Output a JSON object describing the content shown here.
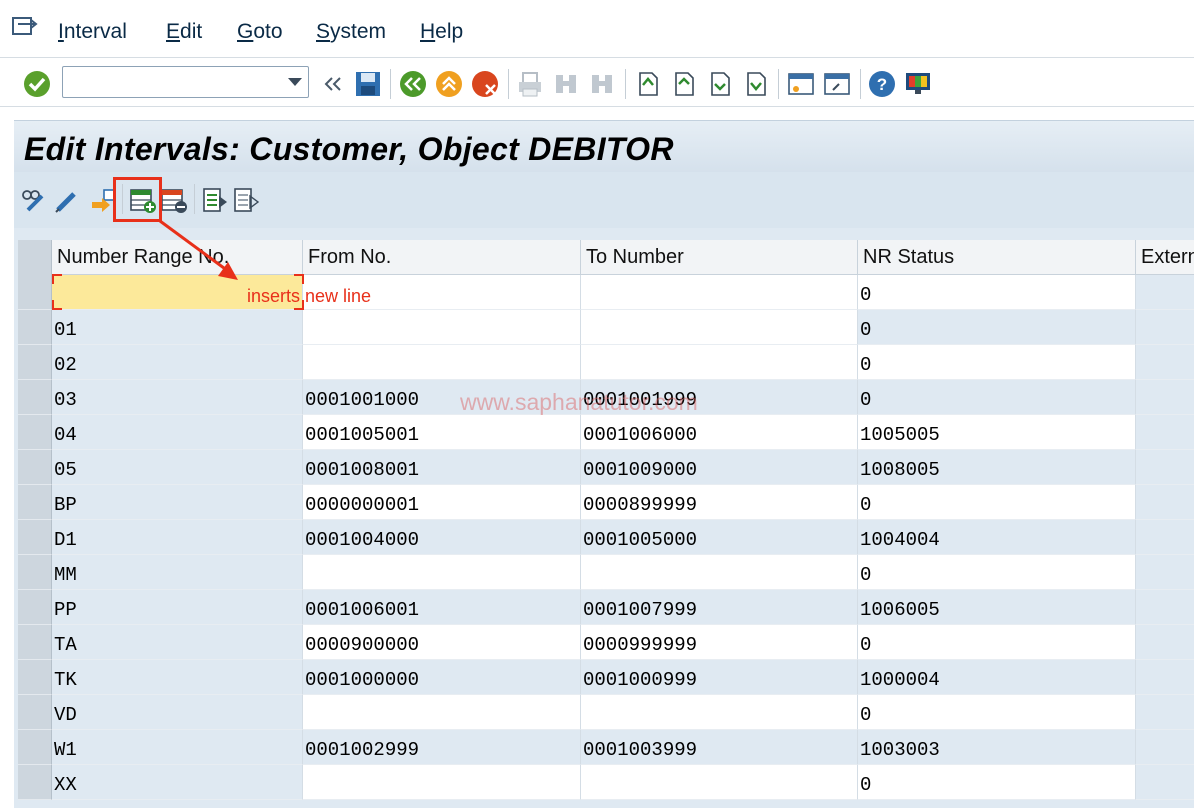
{
  "menu": {
    "items": [
      "Interval",
      "Edit",
      "Goto",
      "System",
      "Help"
    ]
  },
  "toolbar": {
    "command_field_value": "",
    "icons": [
      "enter-icon",
      "back-icon",
      "save-icon",
      "green-back-icon",
      "exit-icon",
      "cancel-icon",
      "print-icon",
      "find-icon",
      "find-next-icon",
      "first-page-icon",
      "prev-page-icon",
      "next-page-icon",
      "last-page-icon",
      "new-session-icon",
      "shortcut-icon",
      "help-icon",
      "customize-layout-icon"
    ]
  },
  "title": "Edit Intervals: Customer, Object DEBITOR",
  "app_toolbar": {
    "icons": [
      "display-change-icon",
      "change-icon",
      "transport-icon",
      "insert-line-icon",
      "delete-line-icon",
      "select-all-icon",
      "deselect-all-icon"
    ]
  },
  "table": {
    "headers": [
      "Number Range No.",
      "From No.",
      "To Number",
      "NR Status",
      "Extern"
    ],
    "rows": [
      {
        "no": "",
        "from": "",
        "to": "",
        "status": "0"
      },
      {
        "no": "01",
        "from": "",
        "to": "",
        "status": "0"
      },
      {
        "no": "02",
        "from": "",
        "to": "",
        "status": "0"
      },
      {
        "no": "03",
        "from": "0001001000",
        "to": "0001001999",
        "status": "0"
      },
      {
        "no": "04",
        "from": "0001005001",
        "to": "0001006000",
        "status": "1005005"
      },
      {
        "no": "05",
        "from": "0001008001",
        "to": "0001009000",
        "status": "1008005"
      },
      {
        "no": "BP",
        "from": "0000000001",
        "to": "0000899999",
        "status": "0"
      },
      {
        "no": "D1",
        "from": "0001004000",
        "to": "0001005000",
        "status": "1004004"
      },
      {
        "no": "MM",
        "from": "",
        "to": "",
        "status": "0"
      },
      {
        "no": "PP",
        "from": "0001006001",
        "to": "0001007999",
        "status": "1006005"
      },
      {
        "no": "TA",
        "from": "0000900000",
        "to": "0000999999",
        "status": "0"
      },
      {
        "no": "TK",
        "from": "0001000000",
        "to": "0001000999",
        "status": "1000004"
      },
      {
        "no": "VD",
        "from": "",
        "to": "",
        "status": "0"
      },
      {
        "no": "W1",
        "from": "0001002999",
        "to": "0001003999",
        "status": "1003003"
      },
      {
        "no": "XX",
        "from": "",
        "to": "",
        "status": "0"
      }
    ]
  },
  "annotation": {
    "text": "inserts new line",
    "color": "#e8301a"
  },
  "watermark": "www.saphanatutor.com"
}
